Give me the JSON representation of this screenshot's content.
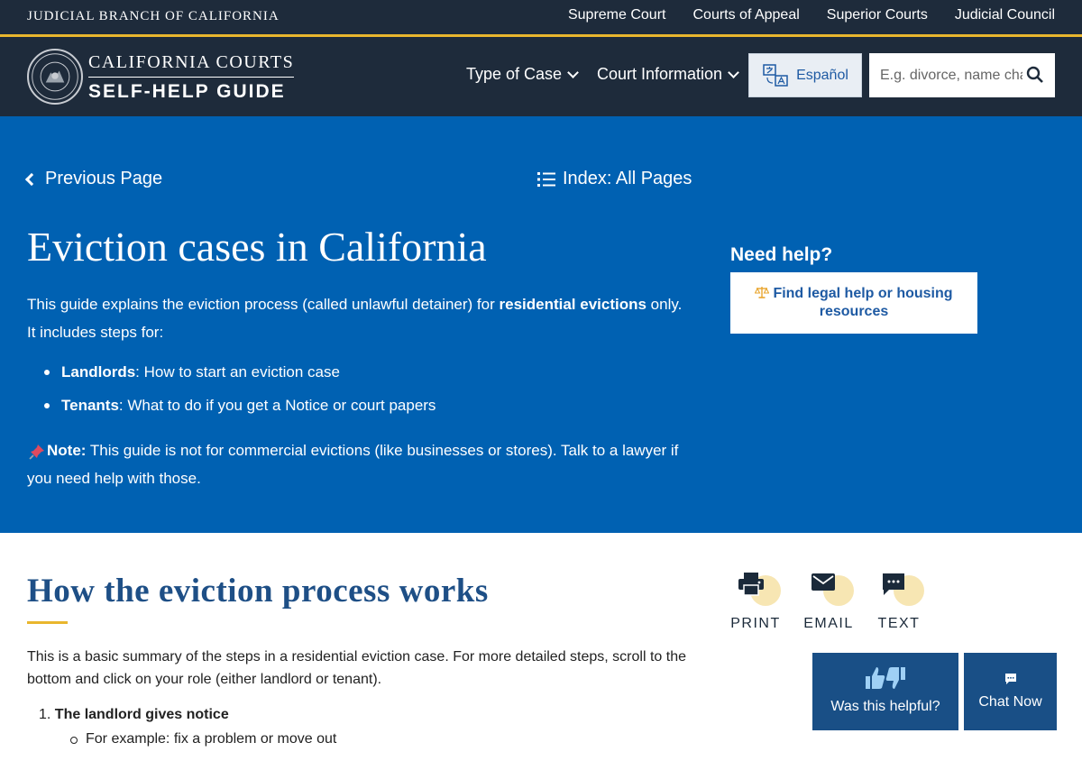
{
  "topbar": {
    "brand": "JUDICIAL BRANCH OF CALIFORNIA",
    "links": [
      "Supreme Court",
      "Courts of Appeal",
      "Superior Courts",
      "Judicial Council"
    ]
  },
  "header": {
    "logo_top": "CALIFORNIA COURTS",
    "logo_bottom": "SELF-HELP GUIDE",
    "nav": [
      "Type of Case",
      "Court Information"
    ],
    "language_button": "Español",
    "search_placeholder": "E.g. divorce, name change,"
  },
  "hero": {
    "previous": "Previous Page",
    "index": "Index: All Pages",
    "title": "Eviction cases in California",
    "intro_pre": "This guide explains the eviction process (called unlawful detainer) for ",
    "intro_bold": "residential evictions",
    "intro_post": " only. It includes steps for:",
    "bullets": [
      {
        "bold": "Landlords",
        "text": ": How to start an eviction case"
      },
      {
        "bold": "Tenants",
        "text": ": What to do if you get a Notice or court papers"
      }
    ],
    "note_label": "Note:",
    "note_text": " This guide is not for commercial evictions (like businesses or stores). Talk to a lawyer if you need help with those.",
    "need_help": "Need help?",
    "help_link": "Find legal help or housing resources"
  },
  "content": {
    "section_title": "How the eviction process works",
    "summary": "This is a basic summary of the steps in a residential eviction case. For more detailed steps, scroll to the bottom and click on your role (either landlord or tenant).",
    "steps": [
      {
        "number": "1.",
        "title": "The landlord gives notice",
        "sub": "For example: fix a problem or move out"
      }
    ]
  },
  "share": {
    "print": "PRINT",
    "email": "EMAIL",
    "text": "TEXT"
  },
  "feedback": {
    "helpful": "Was this helpful?",
    "chat": "Chat Now"
  },
  "colors": {
    "navy": "#1e2b3b",
    "hero_blue": "#0061b2",
    "gold": "#e9b62e",
    "button_blue": "#194f86"
  }
}
